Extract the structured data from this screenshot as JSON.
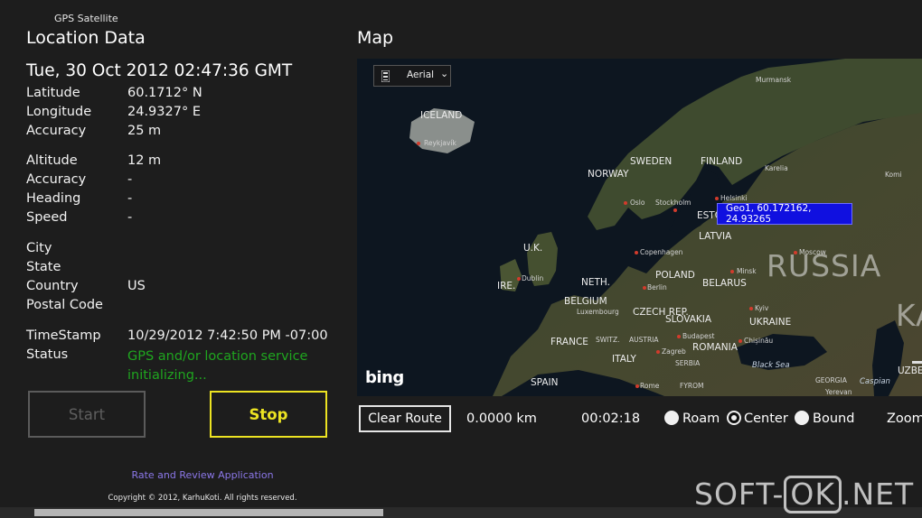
{
  "app": {
    "name": "GPS Satellite"
  },
  "location_panel": {
    "title": "Location Data",
    "datetime": "Tue, 30 Oct 2012 02:47:36 GMT",
    "rows": [
      {
        "label": "Latitude",
        "value": "60.1712° N"
      },
      {
        "label": "Longitude",
        "value": "24.9327° E"
      },
      {
        "label": "Accuracy",
        "value": "25 m"
      },
      {
        "label": "Altitude",
        "value": "12 m"
      },
      {
        "label": "Accuracy",
        "value": "-"
      },
      {
        "label": "Heading",
        "value": "-"
      },
      {
        "label": "Speed",
        "value": "-"
      },
      {
        "label": "City",
        "value": ""
      },
      {
        "label": "State",
        "value": ""
      },
      {
        "label": "Country",
        "value": "US"
      },
      {
        "label": "Postal Code",
        "value": ""
      },
      {
        "label": "TimeStamp",
        "value": "10/29/2012 7:42:50 PM -07:00"
      },
      {
        "label": "Status",
        "value": "GPS and/or location service initializing..."
      }
    ],
    "status_color": "#1fa61f"
  },
  "buttons": {
    "start": "Start",
    "stop": "Stop",
    "stop_color": "#ece322"
  },
  "footer": {
    "rate_link": "Rate and Review Application",
    "copyright": "Copyright © 2012, KarhuKoti. All rights reserved."
  },
  "map": {
    "title": "Map",
    "style_selector": "Aerial",
    "pushpin_label": "Geo1, 60.172162, 24.93265",
    "provider_logo": "bing",
    "labels": {
      "iceland": "ICELAND",
      "reykjavik": "Reykjavík",
      "norway": "NORWAY",
      "sweden": "SWEDEN",
      "finland": "FINLAND",
      "murmansk": "Murmansk",
      "karelia": "Karelia",
      "komi": "Komi",
      "oslo": "Oslo",
      "stockholm": "Stockholm",
      "helsinki": "Helsinki",
      "esto": "ESTO",
      "uk": "U.K.",
      "latvia": "LATVIA",
      "copenhagen": "Copenhagen",
      "dublin": "Dublin",
      "ire": "IRE.",
      "neth": "NETH.",
      "poland": "POLAND",
      "berlin": "Berlin",
      "belarus": "BELARUS",
      "minsk": "Minsk",
      "moscow": "Moscow",
      "russia": "RUSSIA",
      "belgium": "BELGIUM",
      "luxembourg": "Luxembourg",
      "czech": "CZECH REP.",
      "slovakia": "SLOVAKIA",
      "kyiv": "Kyiv",
      "ukraine": "UKRAINE",
      "france": "FRANCE",
      "switz": "SWITZ.",
      "austria": "AUSTRIA",
      "budapest": "Budapest",
      "chisinau": "Chișinău",
      "zagreb": "Zagreb",
      "romania": "ROMANIA",
      "italy": "ITALY",
      "serbia": "SERBIA",
      "black_sea": "Black Sea",
      "spain": "SPAIN",
      "rome": "Rome",
      "fyrom": "FYROM",
      "georgia": "GEORGIA",
      "yerevan": "Yerevan",
      "caspian": "Caspian",
      "uzbe": "UZBE",
      "ka": "KA"
    }
  },
  "map_controls": {
    "clear_route": "Clear Route",
    "distance": "0.0000 km",
    "elapsed": "00:02:18",
    "modes": [
      "Roam",
      "Center",
      "Bound"
    ],
    "selected_mode": "Center",
    "zoom_label": "Zoom"
  },
  "watermark": {
    "part1": "SOFT-",
    "part2": "OK",
    "part3": ".NET"
  }
}
